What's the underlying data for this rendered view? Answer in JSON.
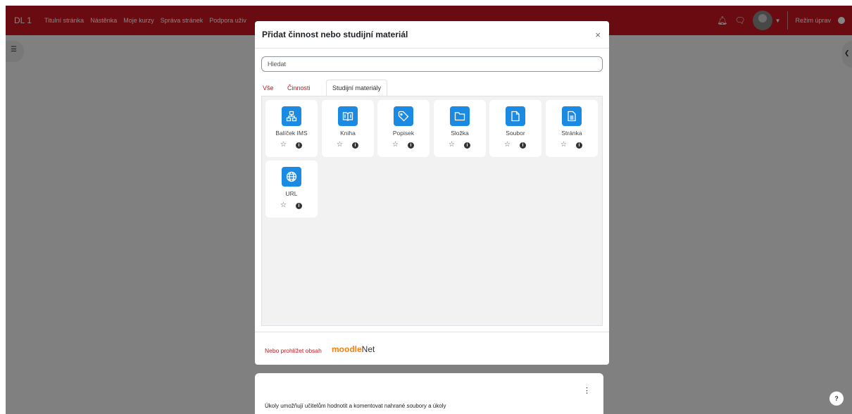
{
  "navbar": {
    "brand": "DL 1",
    "links": [
      "Titulní stránka",
      "Nástěnka",
      "Moje kurzy",
      "Správa stránek",
      "Podpora uživ"
    ],
    "edit_mode_label": "Režim úprav"
  },
  "modal": {
    "title": "Přidat činnost nebo studijní materiál",
    "close": "×",
    "search_placeholder": "Hledat",
    "tabs": [
      "Vše",
      "Činnosti",
      "Studijní materiály"
    ],
    "active_tab": "Studijní materiály",
    "items": [
      {
        "label": "Balíček IMS",
        "icon": "package-icon"
      },
      {
        "label": "Kniha",
        "icon": "book-icon"
      },
      {
        "label": "Popisek",
        "icon": "tag-icon"
      },
      {
        "label": "Složka",
        "icon": "folder-icon"
      },
      {
        "label": "Soubor",
        "icon": "file-icon"
      },
      {
        "label": "Stránka",
        "icon": "page-icon"
      },
      {
        "label": "URL",
        "icon": "globe-icon"
      }
    ],
    "footer_link": "Nebo prohlížet obsah",
    "footer_brand_part1": "moodle",
    "footer_brand_part2": "Net"
  },
  "background_card": {
    "text": "Úkoly umožňují učitelům hodnotit a komentovat nahrané soubory a úkoly"
  },
  "help_label": "?",
  "colors": {
    "brand": "#c9161f",
    "tile_icon": "#1b8ae3",
    "moodle_orange": "#f98012"
  }
}
